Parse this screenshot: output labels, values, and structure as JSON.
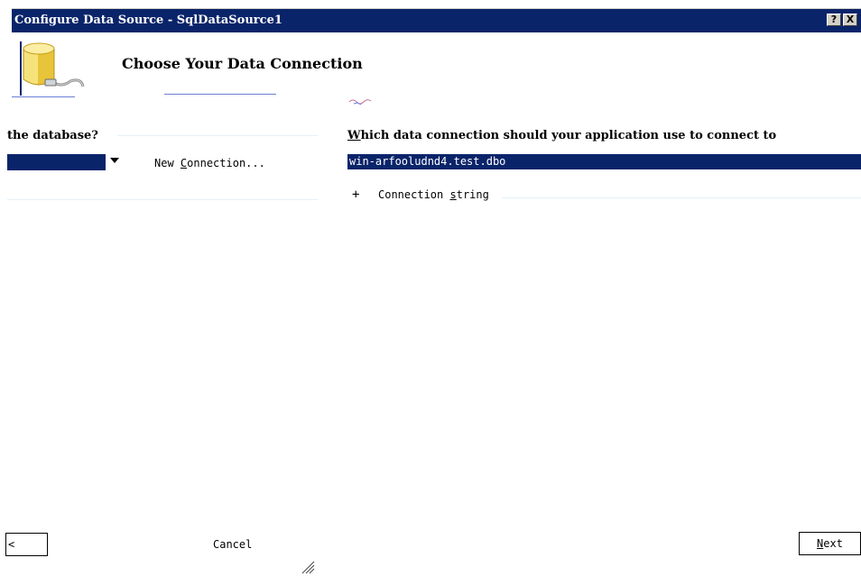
{
  "window": {
    "title": "Configure Data Source - SqlDataSource1",
    "help_button": "?",
    "close_button": "X"
  },
  "header": {
    "heading": "Choose Your Data Connection",
    "icon": "database-connection-icon"
  },
  "left_page": {
    "question": "the database?",
    "new_connection_label": "New Connection...",
    "new_connection_mnemonic_pre": "New ",
    "new_connection_mnemonic": "C",
    "new_connection_mnemonic_post": "onnection..."
  },
  "right_page": {
    "question_mnemonic": "W",
    "question_rest": "hich data connection should your application use to connect to",
    "selected_connection": "win-arfooludnd4.test.dbo",
    "expander_symbol": "+",
    "connection_string_pre": "Connection ",
    "connection_string_mnemonic": "s",
    "connection_string_post": "tring"
  },
  "footer": {
    "previous_label": "<",
    "cancel_label": "Cancel",
    "next_mnemonic": "N",
    "next_rest": "ext"
  },
  "colors": {
    "titlebar": "#0a246a",
    "selection": "#0a246a",
    "accent_line": "#6b7fd6"
  }
}
